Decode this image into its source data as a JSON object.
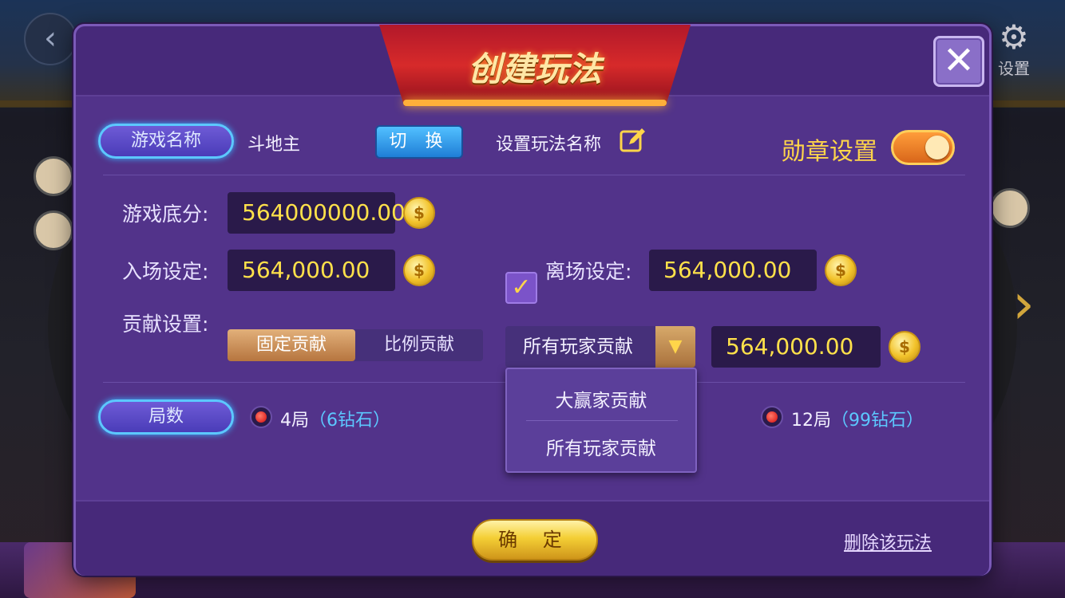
{
  "background": {
    "settings_label": "设置"
  },
  "dialog": {
    "title": "创建玩法",
    "game_name": {
      "label": "游戏名称",
      "value": "斗地主",
      "switch_label": "切 换",
      "set_name_label": "设置玩法名称"
    },
    "medal": {
      "label": "勋章设置",
      "enabled": true
    },
    "base_score": {
      "label": "游戏底分:",
      "value": "564000000.00"
    },
    "entry": {
      "label": "入场设定:",
      "value": "564,000.00"
    },
    "exit": {
      "checked": true,
      "label": "离场设定:",
      "value": "564,000.00"
    },
    "contribution": {
      "label": "贡献设置:",
      "options": [
        "固定贡献",
        "比例贡献"
      ],
      "selected": "固定贡献",
      "dropdown_selected": "所有玩家贡献",
      "dropdown_options": [
        "大赢家贡献",
        "所有玩家贡献"
      ],
      "value": "564,000.00"
    },
    "rounds": {
      "label": "局数",
      "options": [
        {
          "rounds": "4局",
          "cost": "（6钻石）"
        },
        {
          "rounds": "12局",
          "cost": "（99钻石）"
        }
      ]
    },
    "confirm_label": "确 定",
    "delete_label": "删除该玩法"
  },
  "colors": {
    "dialog_bg": "#52338a",
    "value_text": "#ffe14a",
    "accent_blue": "#5cc8ff",
    "medal_gold": "#ffd54a"
  }
}
